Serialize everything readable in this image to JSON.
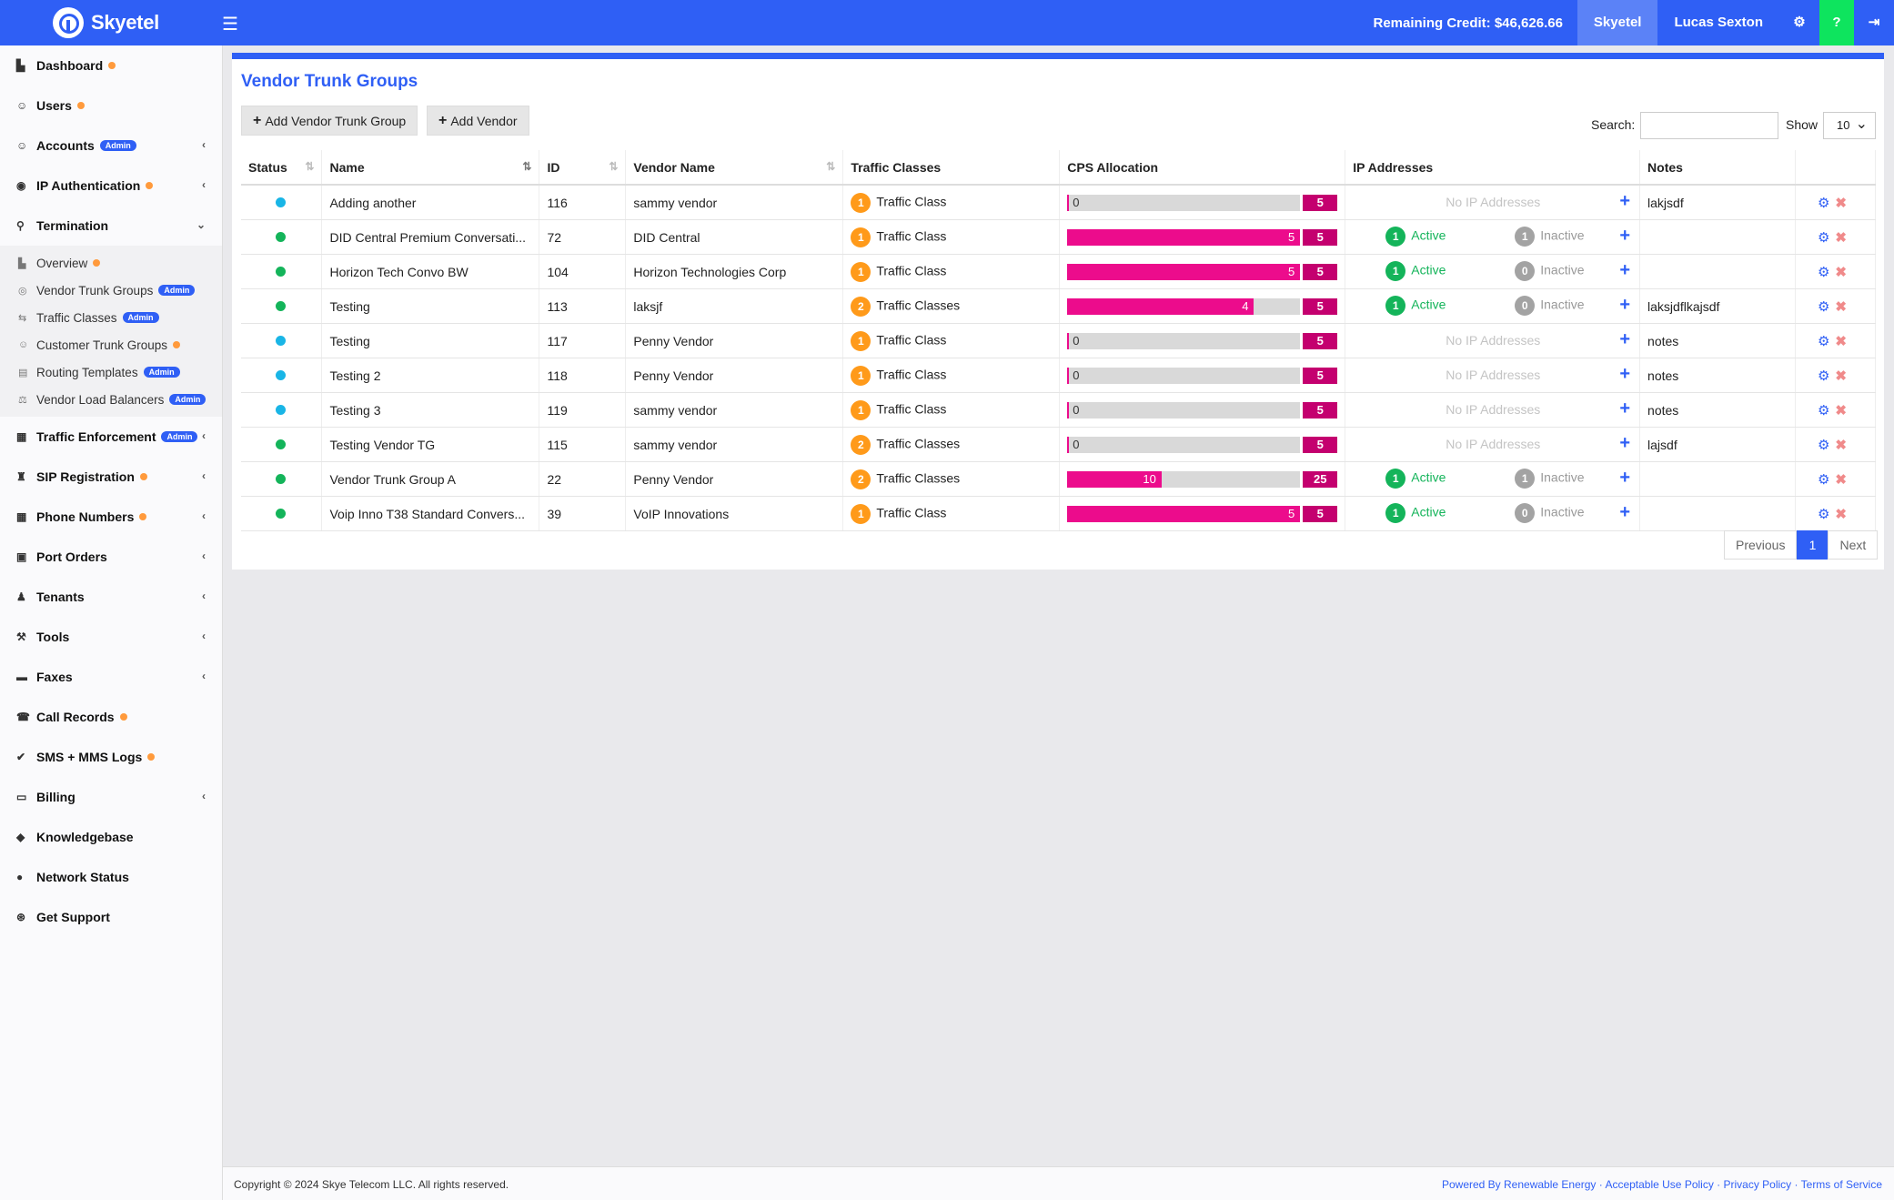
{
  "brand": {
    "name": "Skyetel"
  },
  "topbar": {
    "credit": "Remaining Credit: $46,626.66",
    "account": "Skyetel",
    "user": "Lucas Sexton",
    "help": "?"
  },
  "sidebar": {
    "items": [
      {
        "label": "Dashboard",
        "dot": true
      },
      {
        "label": "Users",
        "dot": true
      },
      {
        "label": "Accounts",
        "badge": "Admin",
        "chevron": "‹"
      },
      {
        "label": "IP Authentication",
        "dot": true,
        "chevron": "‹"
      },
      {
        "label": "Termination",
        "chevron": "⌄"
      },
      {
        "label": "Traffic Enforcement",
        "badge": "Admin",
        "chevron": "‹"
      },
      {
        "label": "SIP Registration",
        "dot": true,
        "chevron": "‹"
      },
      {
        "label": "Phone Numbers",
        "dot": true,
        "chevron": "‹"
      },
      {
        "label": "Port Orders",
        "chevron": "‹"
      },
      {
        "label": "Tenants",
        "chevron": "‹"
      },
      {
        "label": "Tools",
        "chevron": "‹"
      },
      {
        "label": "Faxes",
        "chevron": "‹"
      },
      {
        "label": "Call Records",
        "dot": true
      },
      {
        "label": "SMS + MMS Logs",
        "dot": true
      },
      {
        "label": "Billing",
        "chevron": "‹"
      },
      {
        "label": "Knowledgebase"
      },
      {
        "label": "Network Status"
      },
      {
        "label": "Get Support"
      }
    ],
    "termination_sub": [
      {
        "label": "Overview",
        "dot": true
      },
      {
        "label": "Vendor Trunk Groups",
        "badge": "Admin"
      },
      {
        "label": "Traffic Classes",
        "badge": "Admin"
      },
      {
        "label": "Customer Trunk Groups",
        "dot": true
      },
      {
        "label": "Routing Templates",
        "badge": "Admin"
      },
      {
        "label": "Vendor Load Balancers",
        "badge": "Admin"
      }
    ]
  },
  "page": {
    "title": "Vendor Trunk Groups",
    "add_vtg": "Add Vendor Trunk Group",
    "add_vendor": "Add Vendor",
    "search_label": "Search:",
    "show_label": "Show",
    "show_value": "10"
  },
  "table": {
    "headers": {
      "status": "Status",
      "name": "Name",
      "id": "ID",
      "vendor": "Vendor Name",
      "traffic": "Traffic Classes",
      "cps": "CPS Allocation",
      "ip": "IP Addresses",
      "notes": "Notes"
    },
    "no_ip_text": "No IP Addresses",
    "active_label": "Active",
    "inactive_label": "Inactive",
    "rows": [
      {
        "status": "#19b5e6",
        "name": "Adding another",
        "id": "116",
        "vendor": "sammy vendor",
        "tc_count": "1",
        "tc_label": "Traffic Class",
        "cps_used": 0,
        "cps_max": 5,
        "ip_active": null,
        "ip_inactive": null,
        "notes": "lakjsdf"
      },
      {
        "status": "#14b45a",
        "name": "DID Central Premium Conversati...",
        "id": "72",
        "vendor": "DID Central",
        "tc_count": "1",
        "tc_label": "Traffic Class",
        "cps_used": 5,
        "cps_max": 5,
        "ip_active": "1",
        "ip_inactive": "1",
        "notes": ""
      },
      {
        "status": "#14b45a",
        "name": "Horizon Tech Convo BW",
        "id": "104",
        "vendor": "Horizon Technologies Corp",
        "tc_count": "1",
        "tc_label": "Traffic Class",
        "cps_used": 5,
        "cps_max": 5,
        "ip_active": "1",
        "ip_inactive": "0",
        "notes": ""
      },
      {
        "status": "#14b45a",
        "name": "Testing",
        "id": "113",
        "vendor": "laksjf",
        "tc_count": "2",
        "tc_label": "Traffic Classes",
        "cps_used": 4,
        "cps_max": 5,
        "ip_active": "1",
        "ip_inactive": "0",
        "notes": "laksjdflkajsdf"
      },
      {
        "status": "#19b5e6",
        "name": "Testing",
        "id": "117",
        "vendor": "Penny Vendor",
        "tc_count": "1",
        "tc_label": "Traffic Class",
        "cps_used": 0,
        "cps_max": 5,
        "ip_active": null,
        "ip_inactive": null,
        "notes": "notes"
      },
      {
        "status": "#19b5e6",
        "name": "Testing 2",
        "id": "118",
        "vendor": "Penny Vendor",
        "tc_count": "1",
        "tc_label": "Traffic Class",
        "cps_used": 0,
        "cps_max": 5,
        "ip_active": null,
        "ip_inactive": null,
        "notes": "notes"
      },
      {
        "status": "#19b5e6",
        "name": "Testing 3",
        "id": "119",
        "vendor": "sammy vendor",
        "tc_count": "1",
        "tc_label": "Traffic Class",
        "cps_used": 0,
        "cps_max": 5,
        "ip_active": null,
        "ip_inactive": null,
        "notes": "notes"
      },
      {
        "status": "#14b45a",
        "name": "Testing Vendor TG",
        "id": "115",
        "vendor": "sammy vendor",
        "tc_count": "2",
        "tc_label": "Traffic Classes",
        "cps_used": 0,
        "cps_max": 5,
        "ip_active": null,
        "ip_inactive": null,
        "notes": "lajsdf"
      },
      {
        "status": "#14b45a",
        "name": "Vendor Trunk Group A",
        "id": "22",
        "vendor": "Penny Vendor",
        "tc_count": "2",
        "tc_label": "Traffic Classes",
        "cps_used": 10,
        "cps_max": 25,
        "ip_active": "1",
        "ip_inactive": "1",
        "notes": ""
      },
      {
        "status": "#14b45a",
        "name": "Voip Inno T38 Standard Convers...",
        "id": "39",
        "vendor": "VoIP Innovations",
        "tc_count": "1",
        "tc_label": "Traffic Class",
        "cps_used": 5,
        "cps_max": 5,
        "ip_active": "1",
        "ip_inactive": "0",
        "notes": ""
      }
    ]
  },
  "pagination": {
    "previous": "Previous",
    "current": "1",
    "next": "Next"
  },
  "footer": {
    "copyright": "Copyright © 2024 Skye Telecom LLC. All rights reserved.",
    "links": [
      "Powered By Renewable Energy",
      "Acceptable Use Policy",
      "Privacy Policy",
      "Terms of Service"
    ]
  }
}
